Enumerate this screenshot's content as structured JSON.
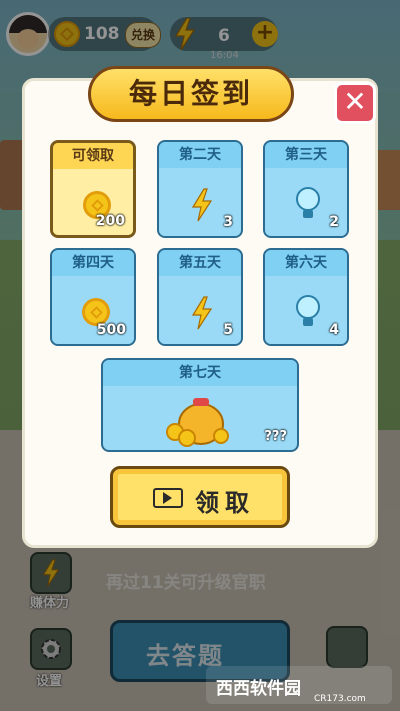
{
  "topbar": {
    "coins": "108",
    "exchange_label": "兑换",
    "energy": "6",
    "energy_timer": "16:04",
    "plus_label": "+"
  },
  "modal": {
    "title": "每日签到",
    "close_label": "✕",
    "days": [
      {
        "label": "可领取",
        "reward": "coin",
        "qty": "200",
        "state": "claimable"
      },
      {
        "label": "第二天",
        "reward": "energy",
        "qty": "3",
        "state": "locked"
      },
      {
        "label": "第三天",
        "reward": "hint-bulb",
        "qty": "2",
        "state": "locked"
      },
      {
        "label": "第四天",
        "reward": "coin",
        "qty": "500",
        "state": "locked"
      },
      {
        "label": "第五天",
        "reward": "energy",
        "qty": "5",
        "state": "locked"
      },
      {
        "label": "第六天",
        "reward": "hint-bulb",
        "qty": "4",
        "state": "locked"
      },
      {
        "label": "第七天",
        "reward": "money-bag",
        "qty": "???",
        "state": "locked"
      }
    ],
    "claim_label": "领取"
  },
  "bottom": {
    "earn_energy_label": "赚体力",
    "level_message": "再过11关可升级官职",
    "answer_label": "去答题",
    "settings_label": "设置"
  },
  "watermark": {
    "text": "西西软件园",
    "sub": "CR173.com"
  },
  "colors": {
    "accent_gold": "#f6b91c",
    "card_blue": "#4db4e6",
    "close_red": "#e0505e",
    "overlay": "rgba(0,0,0,0.42)"
  }
}
